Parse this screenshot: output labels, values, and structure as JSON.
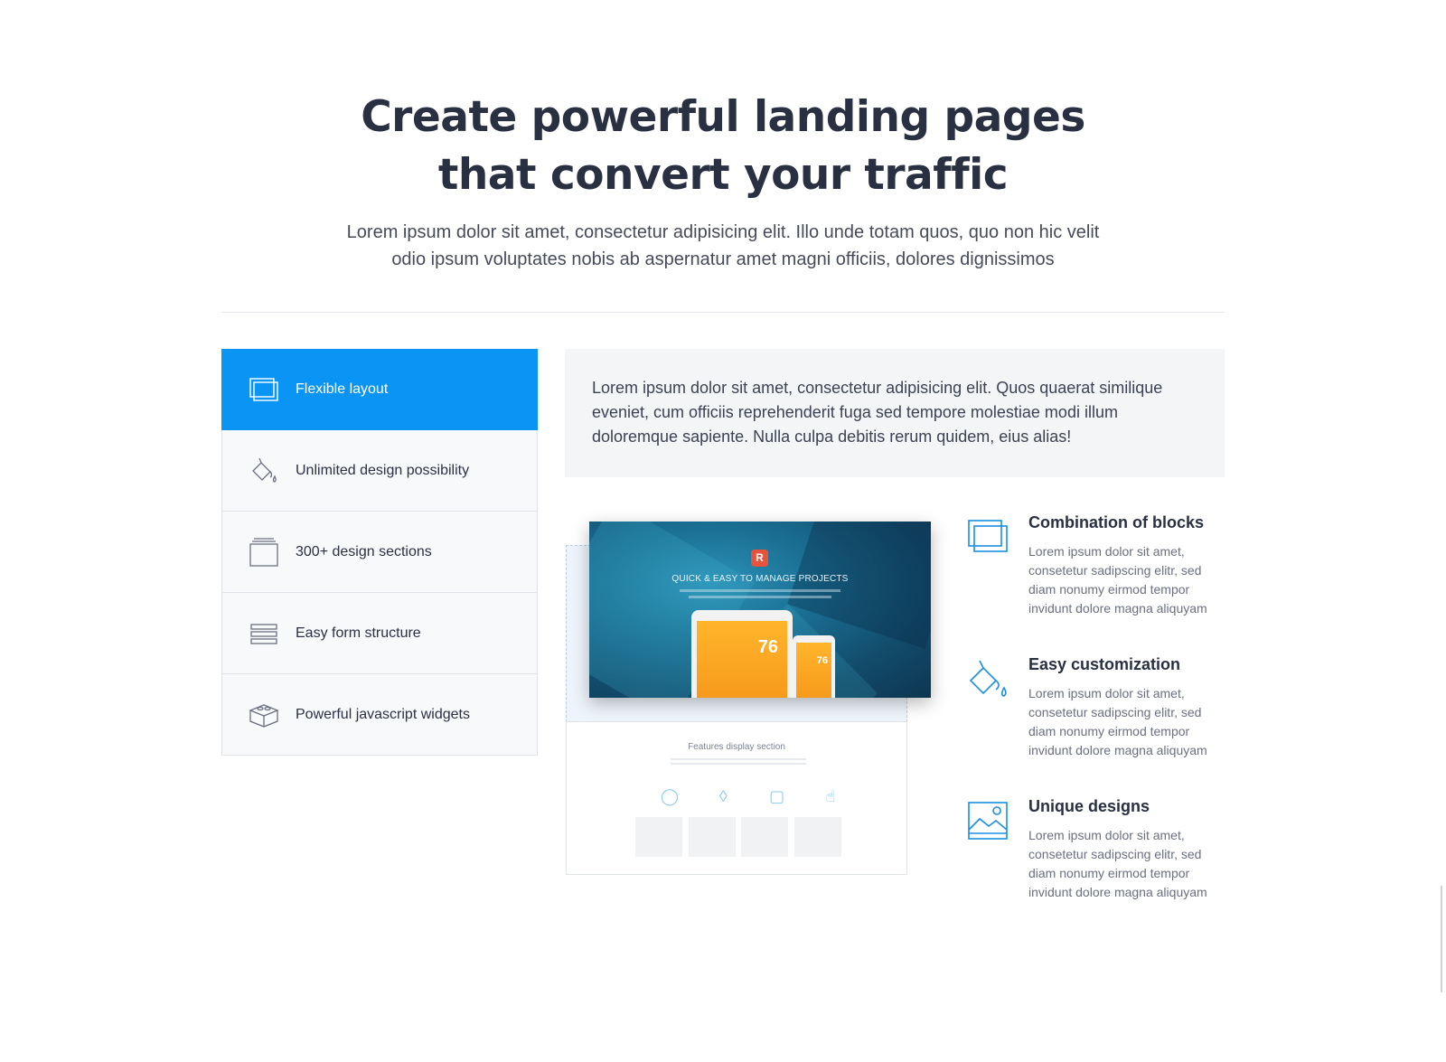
{
  "hero": {
    "title_line1": "Create powerful landing pages",
    "title_line2": "that convert your traffic",
    "subtitle": "Lorem ipsum dolor sit amet, consectetur adipisicing elit. Illo unde totam quos, quo non hic velit odio ipsum voluptates nobis ab aspernatur amet magni officiis, dolores dignissimos"
  },
  "tabs": [
    {
      "label": "Flexible layout",
      "icon": "layers-icon",
      "active": true
    },
    {
      "label": "Unlimited design possibility",
      "icon": "paint-bucket-icon",
      "active": false
    },
    {
      "label": "300+ design sections",
      "icon": "stacked-cards-icon",
      "active": false
    },
    {
      "label": "Easy form structure",
      "icon": "form-lines-icon",
      "active": false
    },
    {
      "label": "Powerful javascript widgets",
      "icon": "box-icon",
      "active": false
    }
  ],
  "description": "Lorem ipsum dolor sit amet, consectetur adipisicing elit. Quos quaerat similique eveniet, cum officiis reprehenderit fuga sed tempore molestiae modi illum doloremque sapiente. Nulla culpa debitis rerum quidem, eius alias!",
  "mockup": {
    "logo_letter": "R",
    "headline": "QUICK & EASY TO MANAGE PROJECTS",
    "temp_tablet": "76",
    "temp_phone": "76",
    "section_title": "Features display section"
  },
  "features": [
    {
      "title": "Combination of blocks",
      "text": "Lorem ipsum dolor sit amet, consetetur sadipscing elitr, sed diam nonumy eirmod tempor invidunt dolore magna aliquyam",
      "icon": "layers-icon"
    },
    {
      "title": "Easy customization",
      "text": "Lorem ipsum dolor sit amet, consetetur sadipscing elitr, sed diam nonumy eirmod tempor invidunt dolore magna aliquyam",
      "icon": "paint-bucket-icon"
    },
    {
      "title": "Unique designs",
      "text": "Lorem ipsum dolor sit amet, consetetur sadipscing elitr, sed diam nonumy eirmod tempor invidunt dolore magna aliquyam",
      "icon": "image-icon"
    }
  ],
  "colors": {
    "accent": "#0a95f5",
    "heading": "#293042",
    "feature_icon": "#1a8fe0"
  }
}
